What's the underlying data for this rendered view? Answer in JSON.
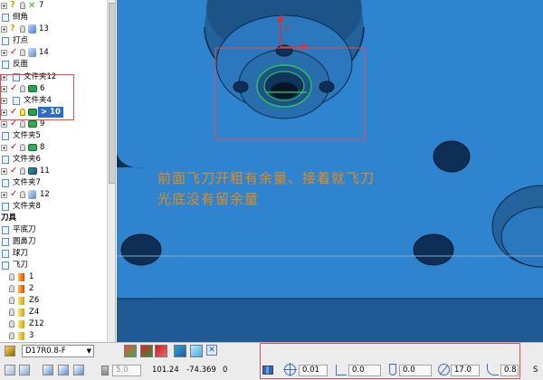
{
  "tree": {
    "rows": [
      {
        "name": "row-7",
        "label": "7",
        "kind": "op"
      },
      {
        "name": "row-chamfer",
        "label": "倒角",
        "kind": "folder"
      },
      {
        "name": "row-13",
        "label": "13",
        "kind": "op"
      },
      {
        "name": "row-spot",
        "label": "打点",
        "kind": "folder"
      },
      {
        "name": "row-14",
        "label": "14",
        "kind": "op"
      },
      {
        "name": "row-reverse",
        "label": "反面",
        "kind": "folder"
      },
      {
        "name": "row-folder12",
        "label": "文件夹12",
        "kind": "folder"
      },
      {
        "name": "row-6",
        "label": "6",
        "kind": "op"
      },
      {
        "name": "row-folder4",
        "label": "文件夹4",
        "kind": "folder"
      },
      {
        "name": "row-10",
        "label": "> 10",
        "kind": "op"
      },
      {
        "name": "row-9",
        "label": "9",
        "kind": "op"
      },
      {
        "name": "row-folder5",
        "label": "文件夹5",
        "kind": "folder"
      },
      {
        "name": "row-8",
        "label": "8",
        "kind": "op"
      },
      {
        "name": "row-folder6",
        "label": "文件夹6",
        "kind": "folder"
      },
      {
        "name": "row-11",
        "label": "11",
        "kind": "op"
      },
      {
        "name": "row-folder7",
        "label": "文件夹7",
        "kind": "folder"
      },
      {
        "name": "row-12",
        "label": "12",
        "kind": "op"
      },
      {
        "name": "row-folder8",
        "label": "文件夹8",
        "kind": "folder"
      },
      {
        "name": "row-toollib",
        "label": "刀具",
        "kind": "header"
      },
      {
        "name": "row-flat",
        "label": "平底刀",
        "kind": "folder"
      },
      {
        "name": "row-bull",
        "label": "圆鼻刀",
        "kind": "folder"
      },
      {
        "name": "row-ball",
        "label": "球刀",
        "kind": "folder"
      },
      {
        "name": "row-fly",
        "label": "飞刀",
        "kind": "folder"
      },
      {
        "name": "row-t1",
        "label": "1",
        "kind": "tool"
      },
      {
        "name": "row-t2",
        "label": "2",
        "kind": "tool"
      },
      {
        "name": "row-z6",
        "label": "Z6",
        "kind": "tool"
      },
      {
        "name": "row-z4",
        "label": "Z4",
        "kind": "tool"
      },
      {
        "name": "row-z12",
        "label": "Z12",
        "kind": "tool"
      },
      {
        "name": "row-t3",
        "label": "3",
        "kind": "tool"
      }
    ]
  },
  "viewport": {
    "note_line1": "前面飞刀开粗有余量、接着就飞刀",
    "note_line2": "光底没有留余量"
  },
  "toolbar": {
    "tool_combo": "D17R0.8-F",
    "field_value": "5.0",
    "coord_x": "101.24",
    "coord_y": "-74.369",
    "coord_z": "0",
    "param_1": "0.01",
    "param_2": "0.0",
    "param_3": "0.0",
    "param_4": "17.0",
    "param_5": "0.8",
    "trailing_s": "S"
  },
  "colors": {
    "viewport_bg": "#2f84d0",
    "annotation": "#e48a1c",
    "selection_box": "#e05050",
    "tree_selected": "#2e6cc8"
  }
}
